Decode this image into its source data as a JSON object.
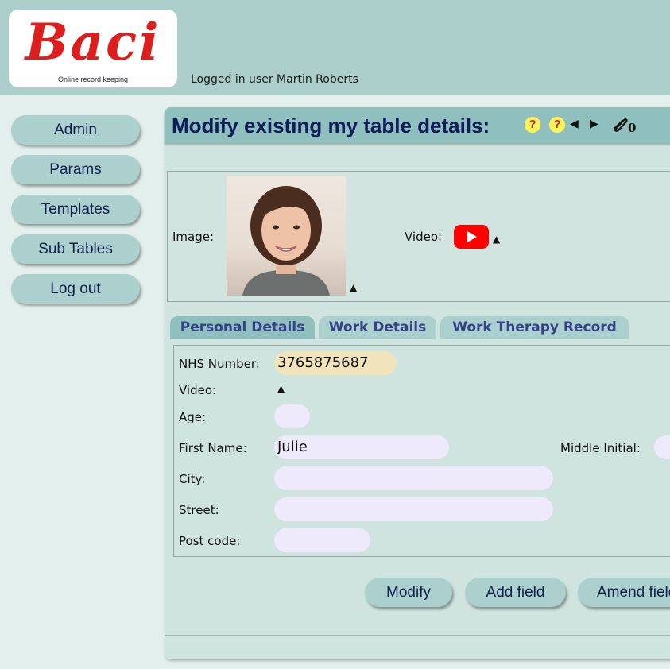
{
  "header": {
    "logo_text": "Baci",
    "logo_tagline": "Online record keeping",
    "user_line": "Logged in user Martin Roberts"
  },
  "nav": {
    "items": [
      {
        "label": "Admin"
      },
      {
        "label": "Params"
      },
      {
        "label": "Templates"
      },
      {
        "label": "Sub Tables"
      },
      {
        "label": "Log out"
      }
    ]
  },
  "main": {
    "title": "Modify existing my table details:",
    "help_icon_glyph": "?",
    "prev_icon_glyph": "◀",
    "next_icon_glyph": "▶",
    "attachment_count": "0",
    "media": {
      "image_label": "Image:",
      "video_label": "Video:",
      "upload_glyph": "▲"
    },
    "tabs": [
      {
        "label": "Personal Details",
        "active": true
      },
      {
        "label": "Work Details",
        "active": false
      },
      {
        "label": "Work Therapy Record",
        "active": false
      }
    ],
    "form": {
      "nhs_label": "NHS Number:",
      "nhs_value": "3765875687",
      "video_label": "Video:",
      "age_label": "Age:",
      "age_value": "",
      "first_name_label": "First Name:",
      "first_name_value": "Julie",
      "middle_initial_label": "Middle Initial:",
      "middle_initial_value": "",
      "city_label": "City:",
      "city_value": "",
      "street_label": "Street:",
      "street_value": "",
      "postcode_label": "Post code:",
      "postcode_value": ""
    },
    "actions": {
      "modify": "Modify",
      "add_field": "Add field",
      "amend_field": "Amend field"
    }
  },
  "colors": {
    "header_bg": "#accfcc",
    "title_text": "#0d1a5c",
    "logo_red": "#de1d1d",
    "youtube_red": "#ff0000",
    "input_bg": "#efe9fc",
    "highlight_input_bg": "#f1e4bb"
  },
  "icons": [
    "help-icon",
    "prev-arrow-icon",
    "next-arrow-icon",
    "paperclip-icon",
    "upload-icon",
    "youtube-icon"
  ]
}
